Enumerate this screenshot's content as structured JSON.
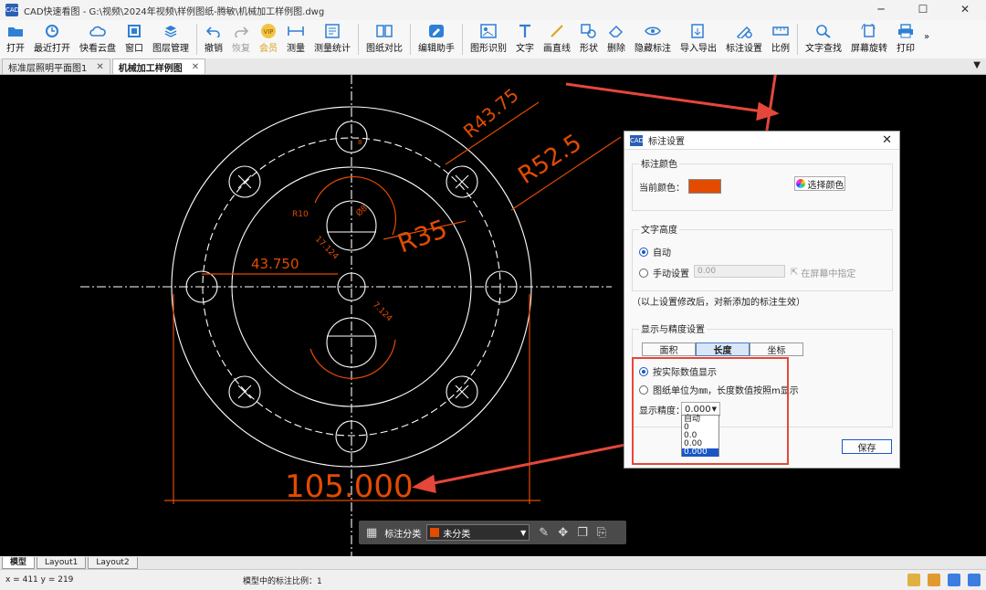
{
  "window": {
    "title": "CAD快速看图 - G:\\视频\\2024年视频\\样例图纸-腾敏\\机械加工样例图.dwg",
    "minimize": "─",
    "maximize": "☐",
    "close": "✕"
  },
  "toolbar": {
    "items": [
      {
        "label": "打开",
        "icon": "folder-icon"
      },
      {
        "label": "最近打开",
        "icon": "clock-icon"
      },
      {
        "label": "快看云盘",
        "icon": "cloud-icon"
      },
      {
        "label": "窗口",
        "icon": "window-icon"
      },
      {
        "label": "图层管理",
        "icon": "layers-icon"
      },
      {
        "label": "撤销",
        "icon": "undo-icon"
      },
      {
        "label": "恢复",
        "icon": "redo-icon"
      },
      {
        "label": "会员",
        "icon": "vip-icon"
      },
      {
        "label": "测量",
        "icon": "measure-icon"
      },
      {
        "label": "测量统计",
        "icon": "measure-stats-icon"
      },
      {
        "label": "图纸对比",
        "icon": "compare-icon"
      },
      {
        "label": "编辑助手",
        "icon": "edit-assistant-icon"
      },
      {
        "label": "图形识别",
        "icon": "shape-recognition-icon"
      },
      {
        "label": "文字",
        "icon": "text-icon"
      },
      {
        "label": "画直线",
        "icon": "line-icon"
      },
      {
        "label": "形状",
        "icon": "shape-icon"
      },
      {
        "label": "删除",
        "icon": "eraser-icon"
      },
      {
        "label": "隐藏标注",
        "icon": "eye-icon"
      },
      {
        "label": "导入导出",
        "icon": "import-export-icon"
      },
      {
        "label": "标注设置",
        "icon": "annotation-settings-icon"
      },
      {
        "label": "比例",
        "icon": "scale-icon"
      },
      {
        "label": "文字查找",
        "icon": "text-search-icon"
      },
      {
        "label": "屏幕旋转",
        "icon": "screen-rotate-icon"
      },
      {
        "label": "打印",
        "icon": "printer-icon"
      }
    ],
    "more": "»"
  },
  "tabs": [
    {
      "label": "标准层照明平面图1",
      "close": "✕"
    },
    {
      "label": "机械加工样例图",
      "close": "✕"
    }
  ],
  "tabs_menu": "▼",
  "drawing": {
    "dims": {
      "r_43_75": "R43.75",
      "r_52_5": "R52.5",
      "r_35": "R35",
      "horizontal_43_750": "43.750",
      "diameter_105": "105.000",
      "r10": "R10",
      "d8": "Ø8",
      "small_17_124_top": "17.124",
      "small_17_124_bottom": "7.124",
      "tiny_8": "8"
    }
  },
  "float_toolbar": {
    "grid_icon": "grid-icon",
    "label": "标注分类",
    "category": "未分类",
    "category_color": "#e34b00"
  },
  "dialog": {
    "title": "标注设置",
    "color_group": {
      "title": "标注颜色",
      "current_label": "当前颜色：",
      "current_color": "#e34b00",
      "choose_button": "选择颜色"
    },
    "text_height_group": {
      "title": "文字高度",
      "auto_label": "自动",
      "manual_label": "手动设置",
      "manual_value": "0.00",
      "screen_pick": "在屏幕中指定"
    },
    "note": "（以上设置修改后，对新添加的标注生效）",
    "display_group": {
      "title": "显示与精度设置",
      "tabs": [
        "面积",
        "长度",
        "坐标"
      ],
      "active_tab": "长度",
      "option_actual": "按实际数值显示",
      "option_mm": "图纸单位为㎜，长度数值按照m显示",
      "precision_label": "显示精度：",
      "precision_value": "0.000",
      "precision_options": [
        "自动",
        "0",
        "0.0",
        "0.00",
        "0.000"
      ]
    },
    "save_button": "保存"
  },
  "layout_tabs": [
    "模型",
    "Layout1",
    "Layout2"
  ],
  "status": {
    "coords": "x = 411  y = 219",
    "scale_text": "模型中的标注比例：1"
  },
  "colors": {
    "accent": "#1a56c6",
    "annotation": "#e34b00",
    "highlight_red": "#e5473b"
  }
}
